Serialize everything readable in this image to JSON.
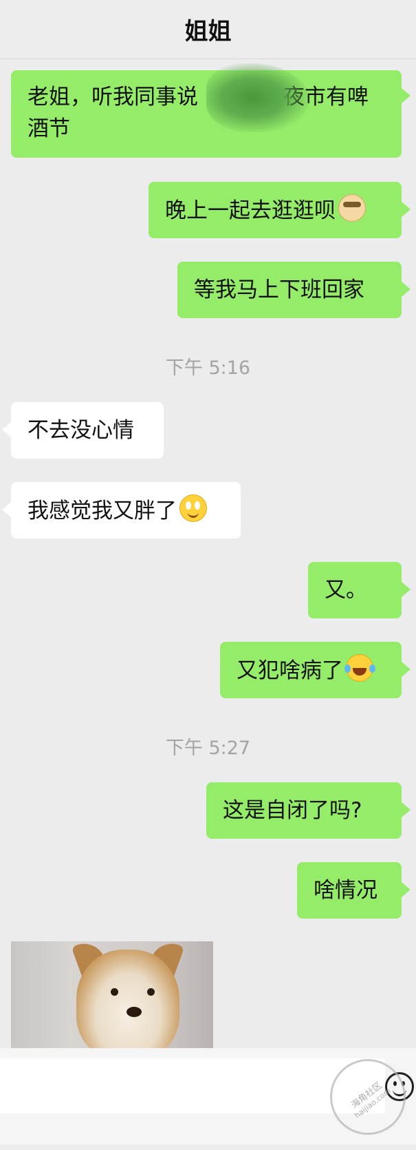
{
  "header": {
    "title": "姐姐"
  },
  "messages": [
    {
      "text": "老姐，听我同事说　　　　夜市有啤酒节"
    },
    {
      "text": "晚上一起去逛逛呗"
    },
    {
      "text": "等我马上下班回家"
    },
    {
      "time": "下午 5:16"
    },
    {
      "text": "不去没心情"
    },
    {
      "text": "我感觉我又胖了"
    },
    {
      "text": "又。"
    },
    {
      "text": "又犯啥病了"
    },
    {
      "time": "下午 5:27"
    },
    {
      "text": "这是自闭了吗?"
    },
    {
      "text": "啥情况"
    }
  ],
  "watermark": {
    "line1": "海角社区",
    "line2": "haijiao.com"
  },
  "colors": {
    "outgoing": "#95ec69",
    "incoming": "#ffffff",
    "background": "#ececec"
  },
  "icons": {
    "emoji_button": "emoji-smile-icon"
  }
}
